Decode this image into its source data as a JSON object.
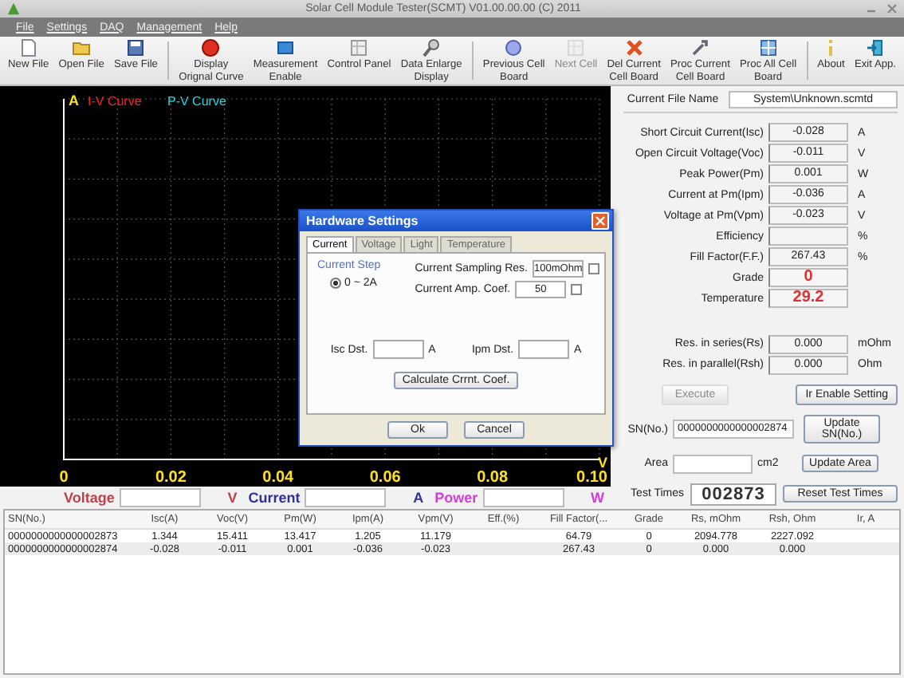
{
  "window": {
    "title": "Solar Cell Module Tester(SCMT) V01.00.00.00 (C) 2011"
  },
  "menu": [
    "File",
    "Settings",
    "DAQ",
    "Management",
    "Help"
  ],
  "toolbar": [
    {
      "label": "New File",
      "kind": "doc",
      "disabled": false,
      "separator_before": false
    },
    {
      "label": "Open File",
      "kind": "folder",
      "disabled": false,
      "separator_before": false
    },
    {
      "label": "Save File",
      "kind": "save",
      "disabled": false,
      "separator_before": false
    },
    {
      "label": "Display\nOrignal Curve",
      "kind": "record",
      "disabled": false,
      "separator_before": true
    },
    {
      "label": "Measurement\nEnable",
      "kind": "box",
      "disabled": false,
      "separator_before": false
    },
    {
      "label": "Control Panel",
      "kind": "panel",
      "disabled": false,
      "separator_before": false
    },
    {
      "label": "Data Enlarge\nDisplay",
      "kind": "zoom",
      "disabled": false,
      "separator_before": false
    },
    {
      "label": "Previous Cell\nBoard",
      "kind": "ball",
      "disabled": false,
      "separator_before": true
    },
    {
      "label": "Next Cell",
      "kind": "panel",
      "disabled": true,
      "separator_before": false
    },
    {
      "label": "Del Current\nCell Board",
      "kind": "delete",
      "disabled": false,
      "separator_before": false
    },
    {
      "label": "Proc Current\nCell Board",
      "kind": "tool",
      "disabled": false,
      "separator_before": false
    },
    {
      "label": "Proc All Cell\nBoard",
      "kind": "grid",
      "disabled": false,
      "separator_before": false
    },
    {
      "label": "About",
      "kind": "info",
      "disabled": false,
      "separator_before": true
    },
    {
      "label": "Exit App.",
      "kind": "exit",
      "disabled": false,
      "separator_before": false
    }
  ],
  "plot": {
    "y_unit": "A",
    "x_unit": "V",
    "legend": [
      {
        "label": "I-V Curve",
        "color": "#ff2020"
      },
      {
        "label": "P-V Curve",
        "color": "#20d8e0"
      }
    ],
    "x_tick_labels": [
      "0",
      "0.02",
      "0.04",
      "0.06",
      "0.08",
      "0.10"
    ]
  },
  "readout": [
    {
      "label": "Voltage",
      "unit": "V",
      "color": "#c0404a"
    },
    {
      "label": "Current",
      "unit": "A",
      "color": "#35309a"
    },
    {
      "label": "Power",
      "unit": "W",
      "color": "#d040d8"
    }
  ],
  "dialog": {
    "title": "Hardware Settings",
    "tabs": [
      {
        "label": "Current",
        "selected": true
      },
      {
        "label": "Voltage",
        "selected": false
      },
      {
        "label": "Light",
        "selected": false
      },
      {
        "label": "Temperature",
        "selected": false
      }
    ],
    "group_title": "Current Step",
    "radio": {
      "label": "0 ~ 2A",
      "selected": true
    },
    "fields": [
      {
        "label": "Current Sampling Res.",
        "value": "100mOhm"
      },
      {
        "label": "Current Amp. Coef.",
        "value": "50"
      }
    ],
    "dst_fields": [
      {
        "label": "Isc Dst.",
        "unit": "A"
      },
      {
        "label": "Ipm Dst.",
        "unit": "A"
      }
    ],
    "calc_button": "Calculate Crrnt. Coef.",
    "buttons": [
      "Ok",
      "Cancel"
    ]
  },
  "panel": {
    "file_label": "Current File Name",
    "file_value": "System\\Unknown.scmtd",
    "results": [
      {
        "label": "Short Circuit Current(Isc)",
        "value": "-0.028",
        "unit": "A",
        "kind": "plain"
      },
      {
        "label": "Open Circuit Voltage(Voc)",
        "value": "-0.011",
        "unit": "V",
        "kind": "plain"
      },
      {
        "label": "Peak Power(Pm)",
        "value": "0.001",
        "unit": "W",
        "kind": "plain"
      },
      {
        "label": "Current at Pm(Ipm)",
        "value": "-0.036",
        "unit": "A",
        "kind": "plain"
      },
      {
        "label": "Voltage at Pm(Vpm)",
        "value": "-0.023",
        "unit": "V",
        "kind": "plain"
      },
      {
        "label": "Efficiency",
        "unit": "%",
        "kind": "plain"
      },
      {
        "label": "Fill Factor(F.F.)",
        "value": "267.43",
        "unit": "%",
        "kind": "plain"
      },
      {
        "label": "Grade",
        "value": "0",
        "kind": "big"
      },
      {
        "label": "Temperature",
        "value": "29.2",
        "kind": "big"
      }
    ],
    "resistances": [
      {
        "label": "Res. in series(Rs)",
        "value": "0.000",
        "unit": "mOhm"
      },
      {
        "label": "Res. in parallel(Rsh)",
        "value": "0.000",
        "unit": "Ohm"
      }
    ],
    "buttons": [
      {
        "label": "Execute",
        "disabled": true
      },
      {
        "label": "Ir Enable Setting",
        "disabled": false
      }
    ],
    "sn": {
      "label": "SN(No.)",
      "value": "0000000000000002874",
      "button": "Update SN(No.)"
    },
    "area": {
      "label": "Area",
      "unit": "cm2",
      "button": "Update Area"
    },
    "test_times": {
      "label": "Test Times",
      "value": "002873",
      "button": "Reset Test Times"
    }
  },
  "table": {
    "columns": [
      "SN(No.)",
      "Isc(A)",
      "Voc(V)",
      "Pm(W)",
      "Ipm(A)",
      "Vpm(V)",
      "Eff.(%)",
      "Fill Factor(...",
      "Grade",
      "Rs, mOhm",
      "Rsh, Ohm",
      "Ir, A"
    ],
    "rows": [
      {
        "selected": false,
        "cells": [
          "0000000000000002873",
          "1.344",
          "15.411",
          "13.417",
          "1.205",
          "11.179",
          "",
          "64.79",
          "0",
          "2094.778",
          "2227.092",
          ""
        ]
      },
      {
        "selected": true,
        "cells": [
          "0000000000000002874",
          "-0.028",
          "-0.011",
          "0.001",
          "-0.036",
          "-0.023",
          "",
          "267.43",
          "0",
          "0.000",
          "0.000",
          ""
        ]
      }
    ]
  }
}
